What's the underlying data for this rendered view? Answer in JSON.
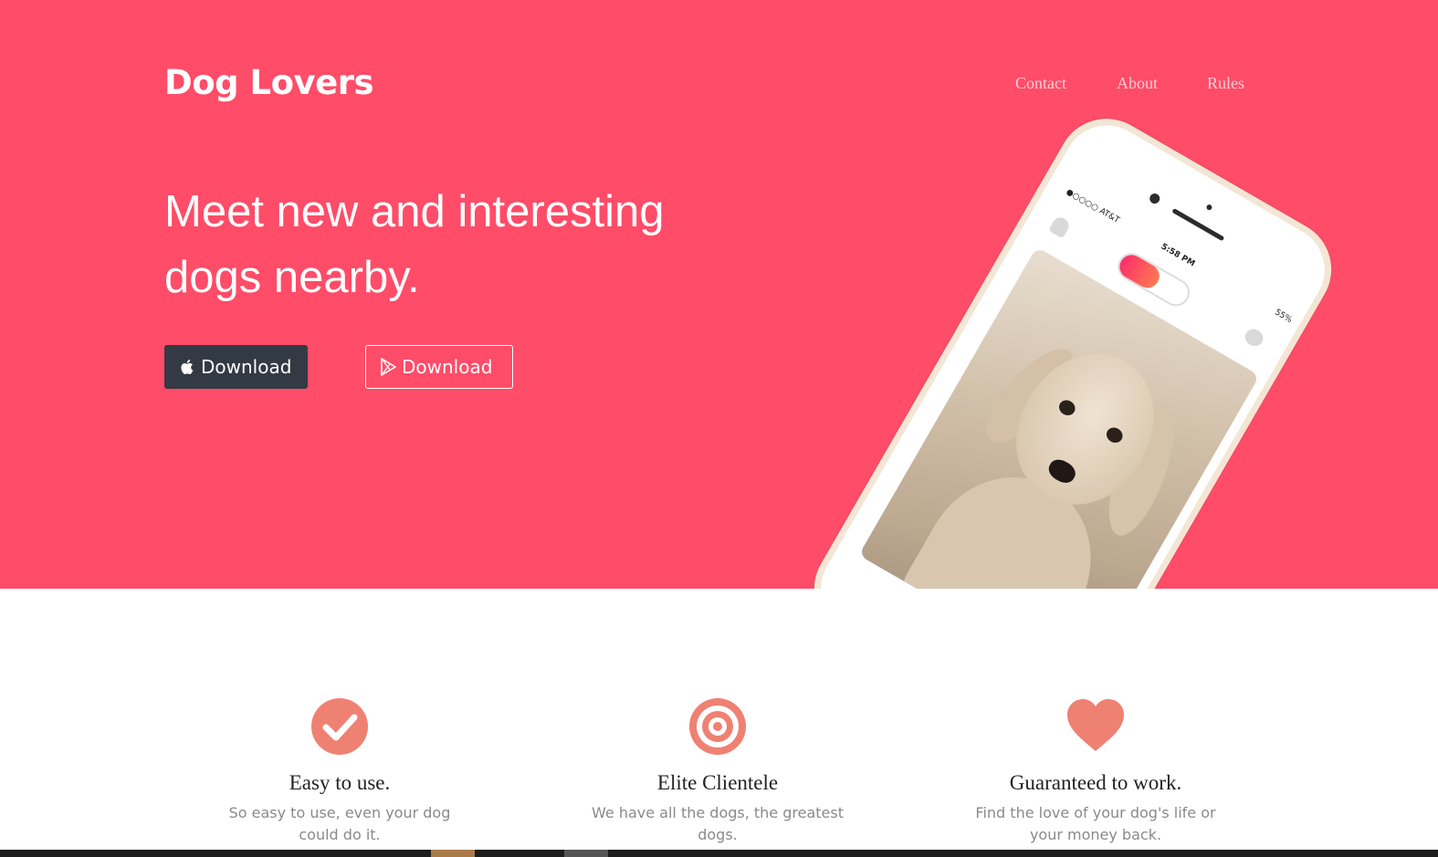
{
  "header": {
    "brand": "Dog Lovers",
    "nav": [
      {
        "label": "Contact"
      },
      {
        "label": "About"
      },
      {
        "label": "Rules"
      }
    ]
  },
  "hero": {
    "headline": "Meet new and interesting dogs nearby.",
    "buttons": [
      {
        "label": "Download",
        "icon": "apple-icon"
      },
      {
        "label": "Download",
        "icon": "google-play-icon"
      }
    ]
  },
  "phone": {
    "carrier": "●○○○○ AT&T",
    "time": "5:58 PM",
    "battery": "55%"
  },
  "features": [
    {
      "icon": "check-circle-icon",
      "title": "Easy to use.",
      "description": "So easy to use, even your dog could do it."
    },
    {
      "icon": "bullseye-icon",
      "title": "Elite Clientele",
      "description": "We have all the dogs, the greatest dogs."
    },
    {
      "icon": "heart-icon",
      "title": "Guaranteed to work.",
      "description": "Find the love of your dog's life or your money back."
    }
  ],
  "colors": {
    "hero_bg": "#ff4c68",
    "icon_accent": "#ef8172",
    "apple_button_bg": "#333a44"
  }
}
